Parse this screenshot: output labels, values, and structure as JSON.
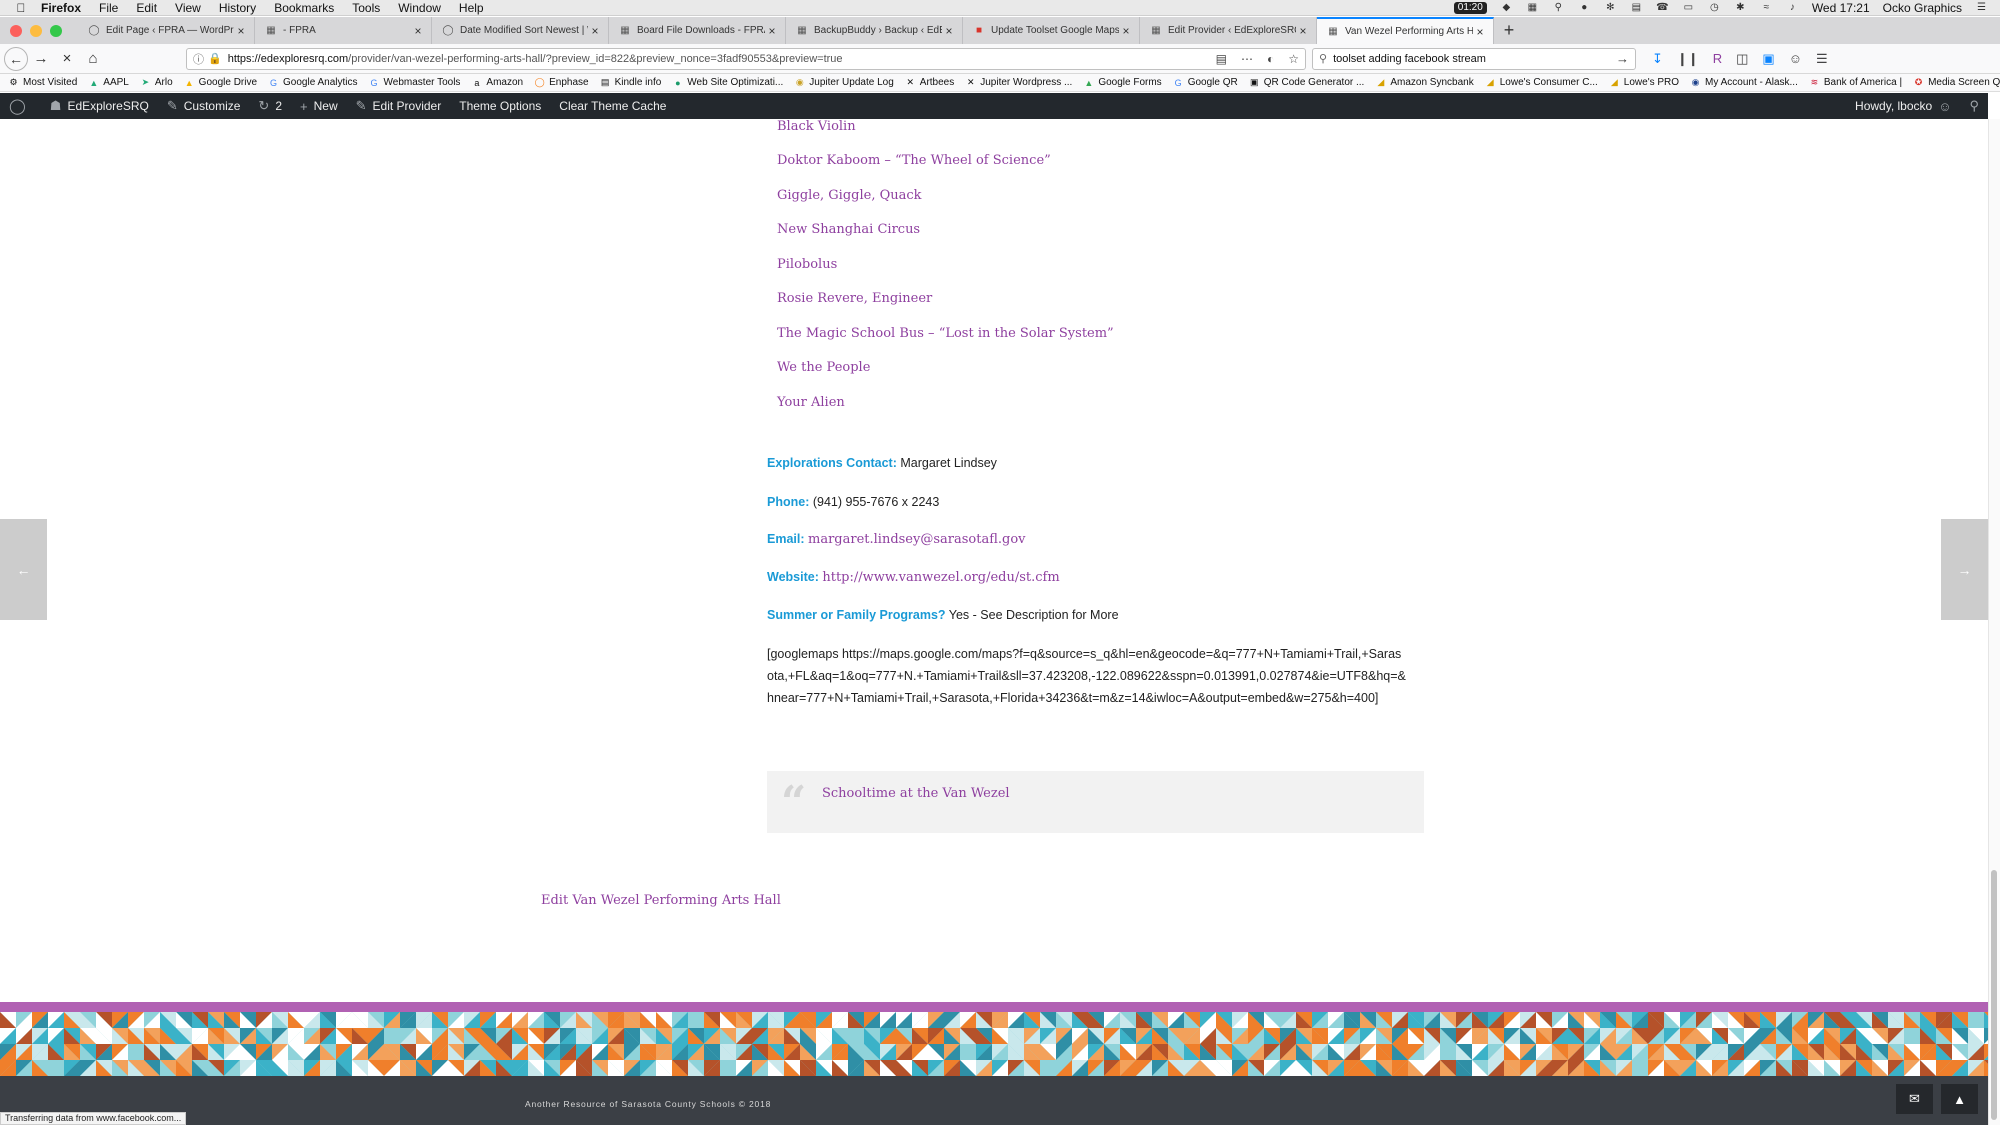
{
  "menubar": {
    "app": "Firefox",
    "items": [
      "File",
      "Edit",
      "View",
      "History",
      "Bookmarks",
      "Tools",
      "Window",
      "Help"
    ],
    "timer": "01:20",
    "clock": "Wed 17:21",
    "user": "Ocko Graphics"
  },
  "tabs": [
    {
      "label": "Edit Page ‹ FPRA — WordPress",
      "icon": "wordpress-icon"
    },
    {
      "label": "- FPRA",
      "icon": "page-icon"
    },
    {
      "label": "Date Modified Sort Newest | Wo",
      "icon": "wordpress-icon"
    },
    {
      "label": "Board File Downloads - FPRA",
      "icon": "page-icon"
    },
    {
      "label": "BackupBuddy › Backup ‹ EdExplore",
      "icon": "page-icon"
    },
    {
      "label": "Update Toolset Google Maps a",
      "icon": "toolset-icon"
    },
    {
      "label": "Edit Provider ‹ EdExploreSRQ — W",
      "icon": "page-icon"
    },
    {
      "label": "Van Wezel Performing Arts Hall",
      "icon": "page-icon",
      "active": true
    }
  ],
  "nav": {
    "url_host": "https://edexploresrq.com",
    "url_path": "/provider/van-wezel-performing-arts-hall/?preview_id=822&preview_nonce=3fadf90553&preview=true",
    "search_value": "toolset adding facebook stream"
  },
  "bookmarks": [
    {
      "label": "Most Visited",
      "icon": "gear-icon"
    },
    {
      "label": "AAPL",
      "icon": "chart-icon"
    },
    {
      "label": "Arlo",
      "icon": "arlo-icon"
    },
    {
      "label": "Google Drive",
      "icon": "drive-icon"
    },
    {
      "label": "Google Analytics",
      "icon": "google-icon"
    },
    {
      "label": "Webmaster Tools",
      "icon": "google-icon"
    },
    {
      "label": "Amazon",
      "icon": "amazon-icon"
    },
    {
      "label": "Enphase",
      "icon": "enphase-icon"
    },
    {
      "label": "Kindle info",
      "icon": "kindle-icon"
    },
    {
      "label": "Web Site Optimizati...",
      "icon": "globe-icon"
    },
    {
      "label": "Jupiter Update Log",
      "icon": "pin-icon"
    },
    {
      "label": "Artbees",
      "icon": "x-icon"
    },
    {
      "label": "Jupiter Wordpress ...",
      "icon": "x-icon"
    },
    {
      "label": "Google Forms",
      "icon": "forms-icon"
    },
    {
      "label": "Google QR",
      "icon": "google-icon"
    },
    {
      "label": "QR Code Generator ...",
      "icon": "qr-icon"
    },
    {
      "label": "Amazon Syncbank",
      "icon": "folder-icon"
    },
    {
      "label": "Lowe's Consumer C...",
      "icon": "folder-icon"
    },
    {
      "label": "Lowe's PRO",
      "icon": "folder-icon"
    },
    {
      "label": "My Account - Alask...",
      "icon": "alaska-icon"
    },
    {
      "label": "Bank of America |",
      "icon": "bofa-icon"
    },
    {
      "label": "Media Screen Queries",
      "icon": "media-icon"
    }
  ],
  "adminbar": {
    "site": "EdExploreSRQ",
    "customize": "Customize",
    "updates": "2",
    "new": "New",
    "edit": "Edit Provider",
    "theme": "Theme Options",
    "cache": "Clear Theme Cache",
    "howdy": "Howdy, lbocko"
  },
  "shows": [
    "Black Violin",
    "Doktor Kaboom – “The Wheel of Science”",
    "Giggle, Giggle, Quack",
    "New Shanghai Circus",
    "Pilobolus",
    "Rosie Revere, Engineer",
    "The Magic School Bus – “Lost in the Solar System”",
    "We the People",
    "Your Alien"
  ],
  "details": {
    "contact_label": "Explorations Contact:",
    "contact_value": "Margaret Lindsey",
    "phone_label": "Phone:",
    "phone_value": "(941) 955-7676 x 2243",
    "email_label": "Email:",
    "email_value": "margaret.lindsey@sarasotafl.gov",
    "website_label": "Website:",
    "website_value": "http://www.vanwezel.org/edu/st.cfm",
    "summer_label": "Summer or Family Programs?",
    "summer_value": "Yes - See Description for More"
  },
  "shortcode": "[googlemaps https://maps.google.com/maps?f=q&source=s_q&hl=en&geocode=&q=777+N+Tamiami+Trail,+Sarasota,+FL&aq=1&oq=777+N.+Tamiami+Trail&sll=37.423208,-122.089622&sspn=0.013991,0.027874&ie=UTF8&hq=&hnear=777+N+Tamiami+Trail,+Sarasota,+Florida+34236&t=m&z=14&iwloc=A&output=embed&w=275&h=400]",
  "quote": "Schooltime at the Van Wezel",
  "edit_link": "Edit Van Wezel Performing Arts Hall",
  "footer": "Another Resource of Sarasota County Schools © 2018",
  "status": "Transferring data from www.facebook.com...",
  "colors": {
    "link": "#8e3f9f",
    "label": "#1a9ad6",
    "admin_bar": "#23282d",
    "footer_stripe": "#b161b3"
  }
}
